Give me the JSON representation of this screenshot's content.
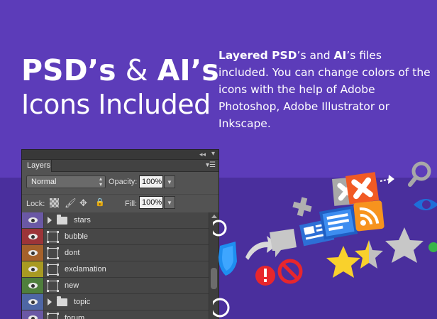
{
  "headline": {
    "line1_bold_a": "PSD’s",
    "line1_amp": " & ",
    "line1_bold_b": "AI’s",
    "line2": "Icons Included"
  },
  "description": {
    "bold1": "Layered PSD",
    "text1": "’s and ",
    "bold2": "AI",
    "text2": "’s files included. You can change colors of the icons with the help of Adobe Photoshop, Adobe Illustrator or Inkscape."
  },
  "panel": {
    "collapse_icon": "double-chevron-left-icon",
    "close_icon": "close-icon",
    "tab_label": "Layers",
    "menu_icon": "panel-menu-icon",
    "blend_mode": "Normal",
    "opacity_label": "Opacity:",
    "opacity_value": "100%",
    "lock_label": "Lock:",
    "fill_label": "Fill:",
    "fill_value": "100%",
    "layers": [
      {
        "name": "stars",
        "type": "folder",
        "color": "#6a58a5"
      },
      {
        "name": "bubble",
        "type": "smart",
        "color": "#9c3438"
      },
      {
        "name": "dont",
        "type": "smart",
        "color": "#a5612b"
      },
      {
        "name": "exclamation",
        "type": "smart",
        "color": "#a89a22"
      },
      {
        "name": "new",
        "type": "smart",
        "color": "#4f7f3c"
      },
      {
        "name": "topic",
        "type": "folder",
        "color": "#4e66a4"
      },
      {
        "name": "forum",
        "type": "smart",
        "color": "#6a58a5"
      }
    ]
  },
  "colors": {
    "background_top": "#5c3cb9",
    "background_bottom": "#4a2f9d",
    "panel_bg": "#535353"
  }
}
